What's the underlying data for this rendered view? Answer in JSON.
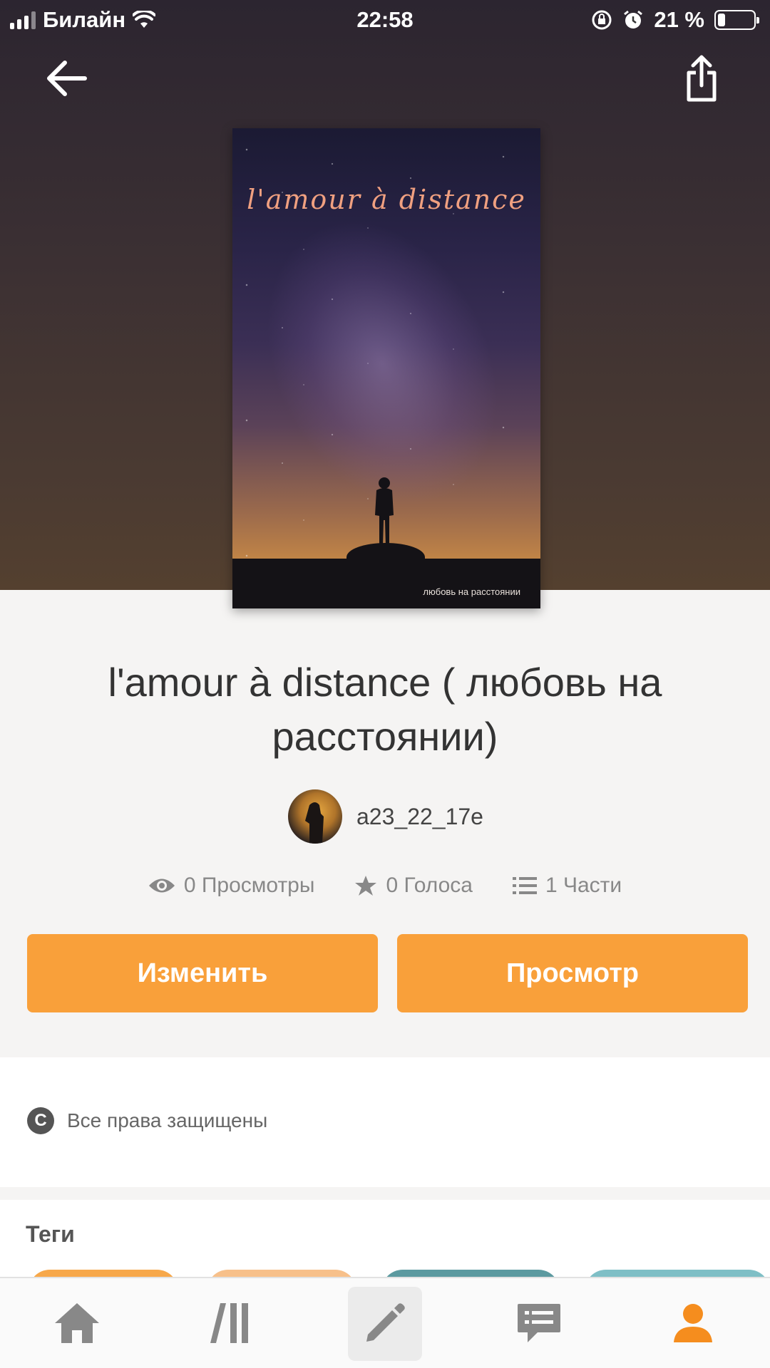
{
  "status_bar": {
    "carrier": "Билайн",
    "time": "22:58",
    "battery_percent": "21 %",
    "battery_level": 0.21
  },
  "header": {
    "back_icon": "arrow-left-icon",
    "share_icon": "share-icon"
  },
  "cover": {
    "title_text": "l'amour à distance",
    "subtitle_text": "любовь на расстоянии"
  },
  "book": {
    "title": "l'amour à distance ( любовь на расстоянии)",
    "author": "a23_22_17e"
  },
  "stats": {
    "views": "0 Просмотры",
    "votes": "0 Голоса",
    "parts": "1 Части"
  },
  "actions": {
    "edit_label": "Изменить",
    "preview_label": "Просмотр"
  },
  "rights": {
    "label": "Все права защищены"
  },
  "tags": {
    "title": "Теги"
  },
  "bottom_nav": {
    "items": [
      "home-icon",
      "library-icon",
      "write-icon",
      "messages-icon",
      "profile-icon"
    ],
    "active": "profile-icon"
  },
  "colors": {
    "accent": "#f9a03a",
    "text": "#333333",
    "muted": "#888888"
  }
}
